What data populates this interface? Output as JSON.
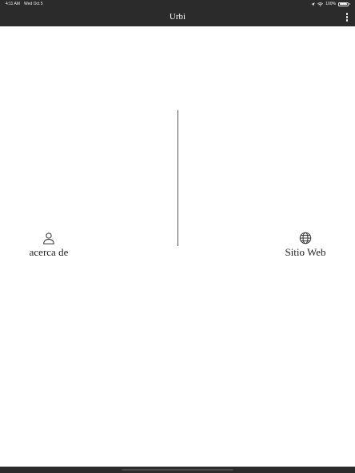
{
  "status_bar": {
    "time": "4:11 AM",
    "date": "Wed Oct 5",
    "battery": "100%"
  },
  "app_bar": {
    "title": "Urbi"
  },
  "nav": {
    "about_label": "acerca de",
    "website_label": "Sitio Web"
  },
  "icons": {
    "about": "person-icon",
    "website": "globe-icon",
    "menu": "more-vert-icon"
  },
  "colors": {
    "bar": "#2b2b2b",
    "background": "#ffffff",
    "text": "#222222"
  }
}
